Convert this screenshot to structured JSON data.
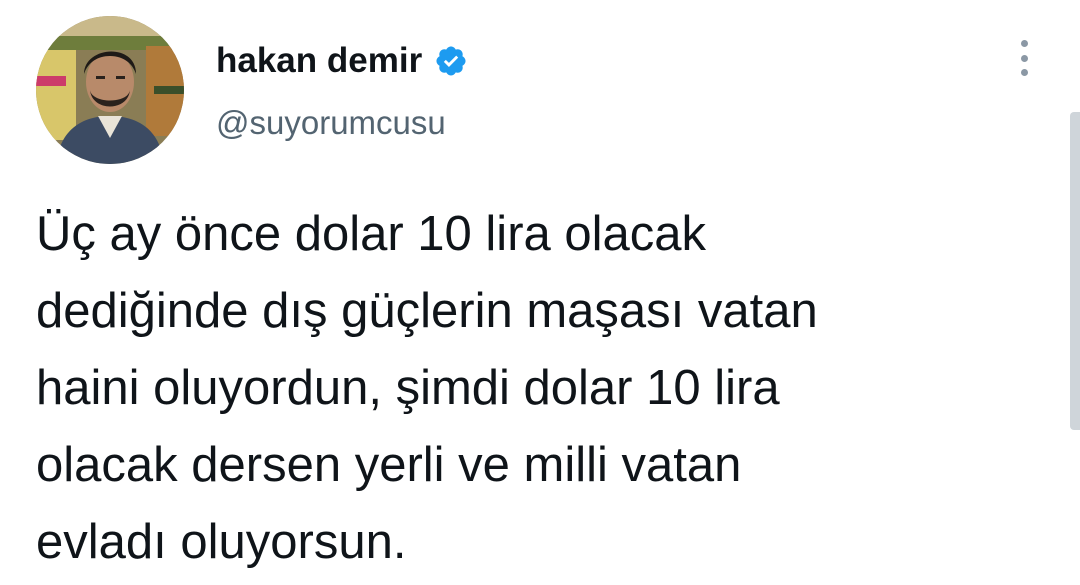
{
  "author": {
    "display_name": "hakan demir",
    "handle": "@suyorumcusu",
    "verified": true,
    "avatar_icon": "profile-photo",
    "verified_icon": "verified-badge-icon",
    "accent_color": "#1d9bf0"
  },
  "menu": {
    "icon": "more-options-icon"
  },
  "tweet": {
    "lines": [
      "Üç ay önce dolar 10 lira olacak",
      "dediğinde dış güçlerin maşası vatan",
      "haini oluyordun, şimdi dolar 10 lira",
      "olacak dersen yerli ve milli vatan",
      "evladı oluyorsun."
    ]
  }
}
